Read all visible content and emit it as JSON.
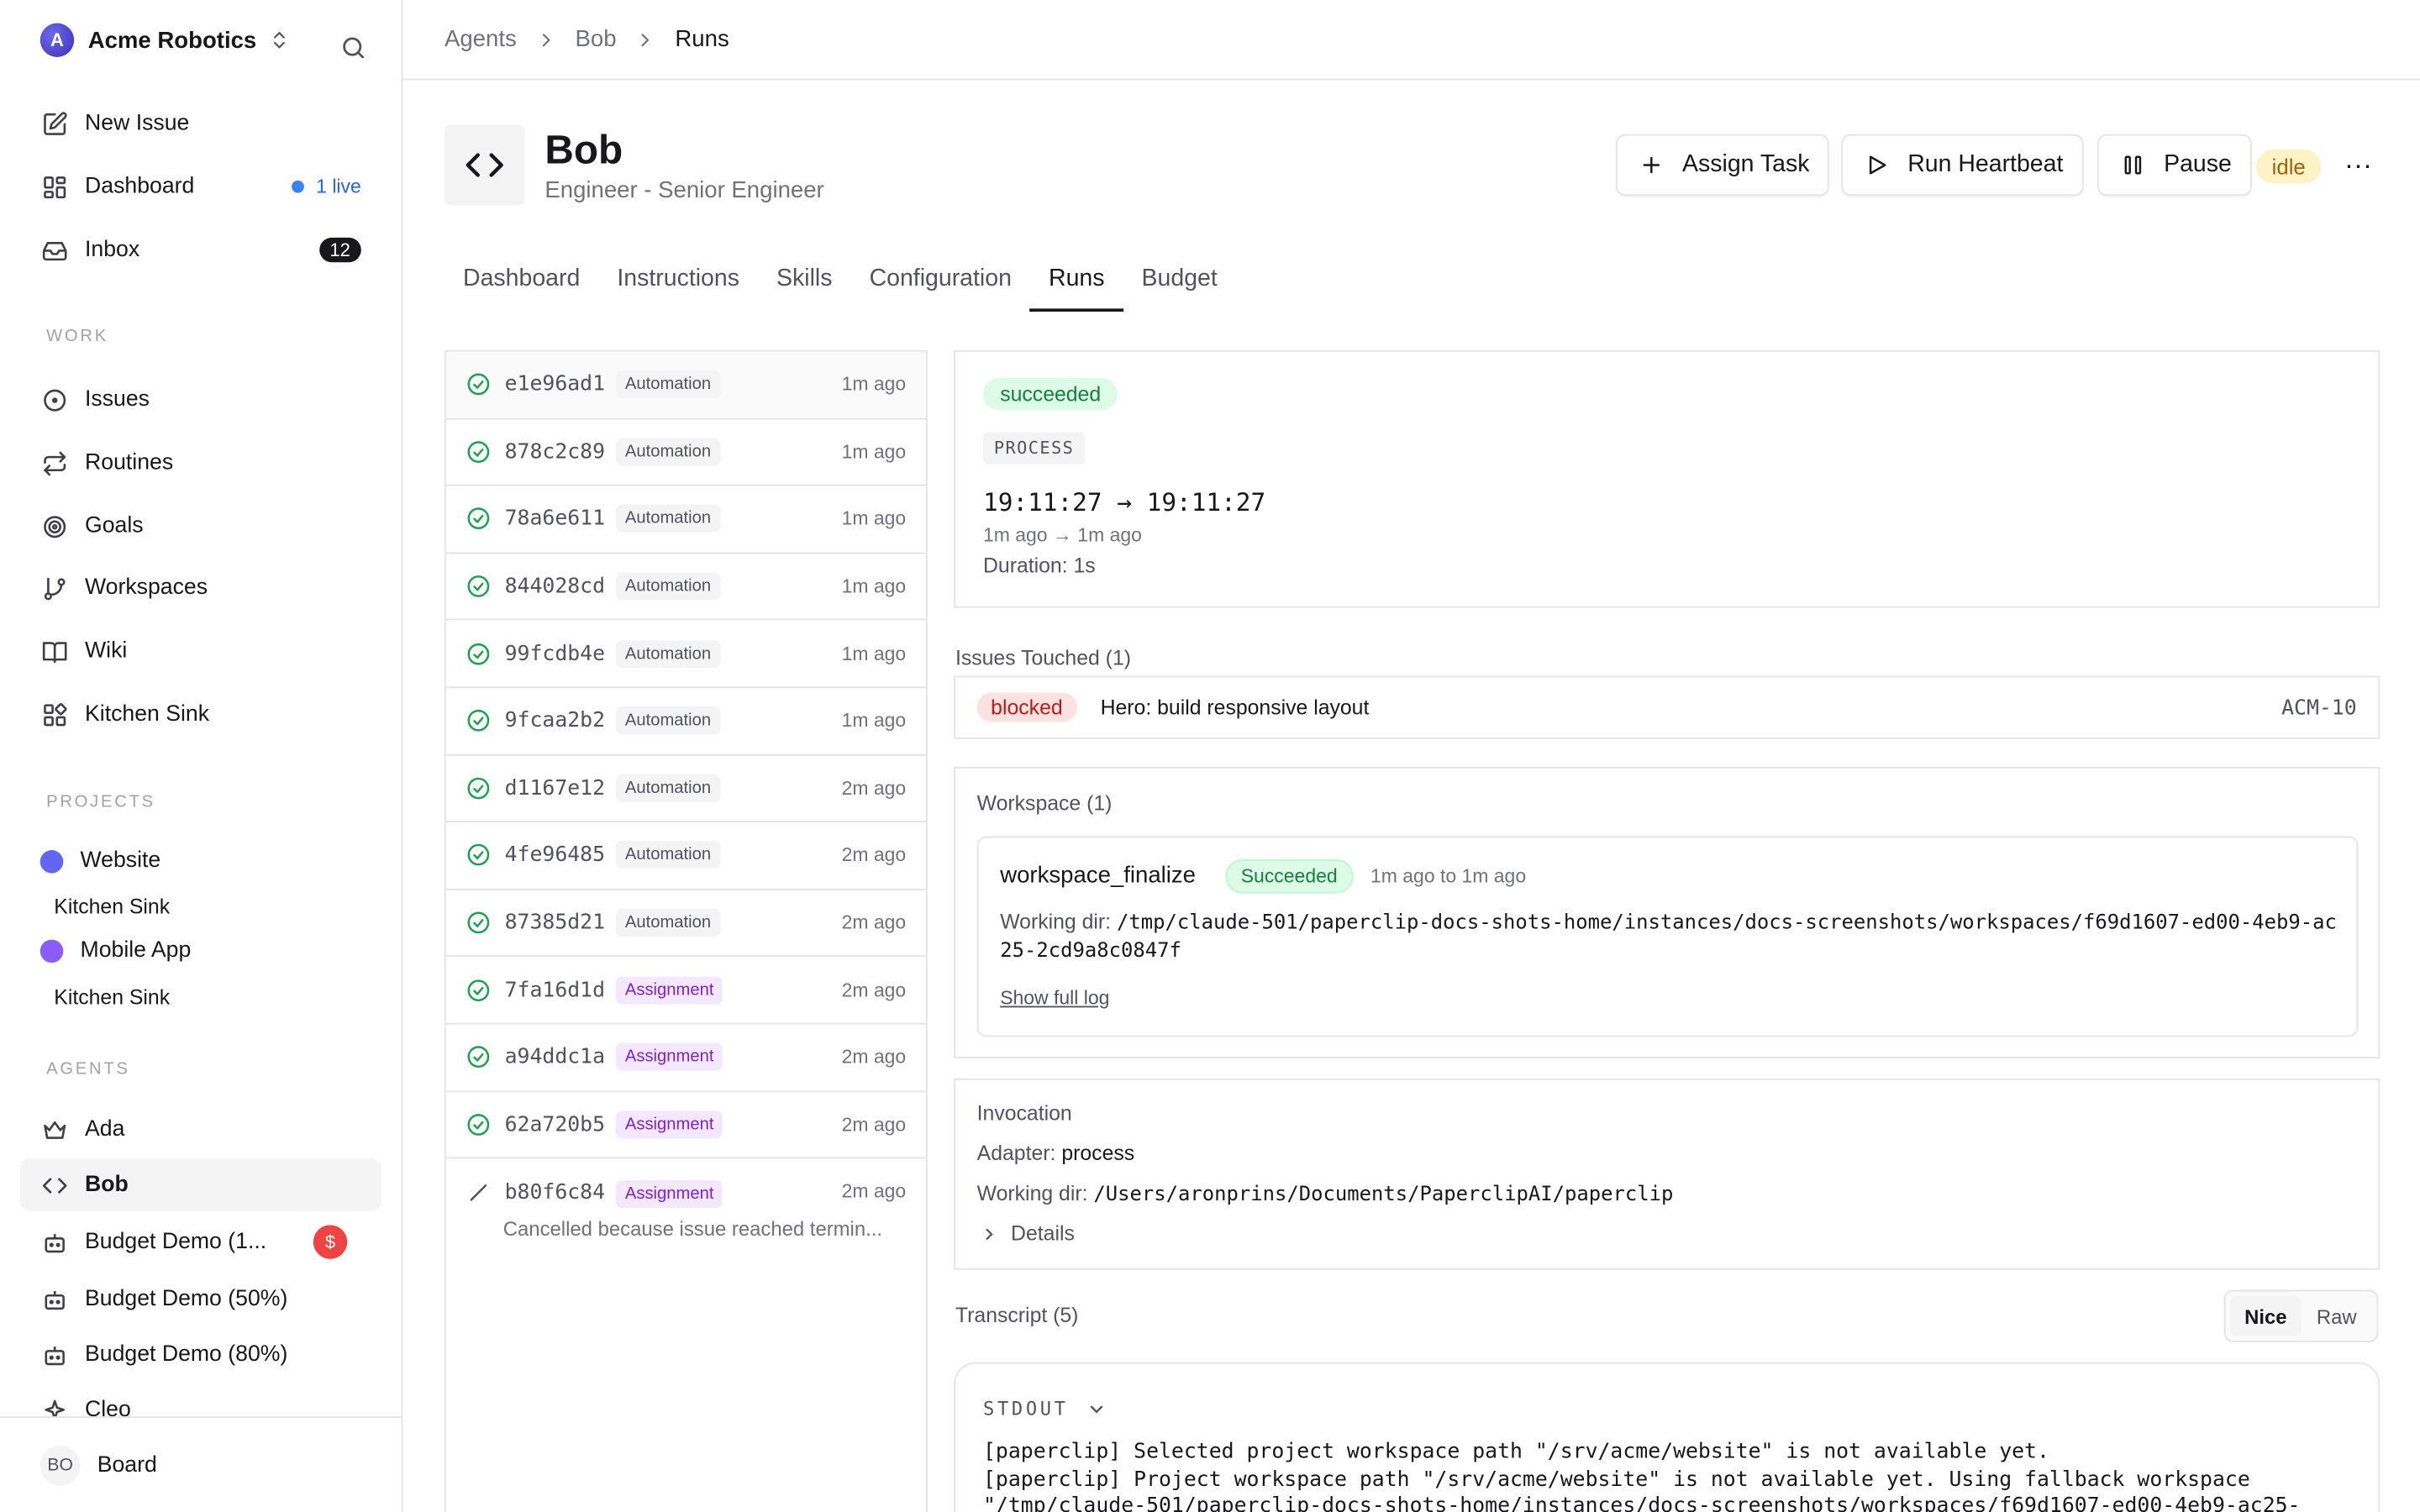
{
  "sidebar": {
    "company": "Acme Robotics",
    "company_initial": "A",
    "nav": [
      {
        "label": "New Issue",
        "icon": "edit-icon"
      },
      {
        "label": "Dashboard",
        "icon": "dashboard-icon",
        "live": "1 live"
      },
      {
        "label": "Inbox",
        "icon": "inbox-icon",
        "count": "12"
      }
    ],
    "work_label": "WORK",
    "work": [
      {
        "label": "Issues",
        "icon": "circle-dot-icon"
      },
      {
        "label": "Routines",
        "icon": "repeat-icon"
      },
      {
        "label": "Goals",
        "icon": "target-icon"
      },
      {
        "label": "Workspaces",
        "icon": "git-branch-icon"
      },
      {
        "label": "Wiki",
        "icon": "book-icon"
      },
      {
        "label": "Kitchen Sink",
        "icon": "blocks-icon"
      }
    ],
    "projects_label": "PROJECTS",
    "projects": [
      {
        "label": "Website",
        "color": "#6366f1",
        "sub": "Kitchen Sink"
      },
      {
        "label": "Mobile App",
        "color": "#8b5cf6",
        "sub": "Kitchen Sink"
      }
    ],
    "agents_label": "AGENTS",
    "agents": [
      {
        "label": "Ada",
        "icon": "crown-icon"
      },
      {
        "label": "Bob",
        "icon": "code-icon"
      },
      {
        "label": "Budget Demo (1...",
        "icon": "bot-icon",
        "badge": "$"
      },
      {
        "label": "Budget Demo (50%)",
        "icon": "bot-icon"
      },
      {
        "label": "Budget Demo (80%)",
        "icon": "bot-icon"
      },
      {
        "label": "Cleo",
        "icon": "sparkle-icon"
      }
    ],
    "footer": {
      "initials": "BO",
      "label": "Board"
    }
  },
  "breadcrumb": [
    "Agents",
    "Bob",
    "Runs"
  ],
  "agent": {
    "name": "Bob",
    "role": "Engineer - Senior Engineer",
    "status": "idle"
  },
  "actions": {
    "assign": "Assign Task",
    "heartbeat": "Run Heartbeat",
    "pause": "Pause",
    "more": "···"
  },
  "tabs": [
    "Dashboard",
    "Instructions",
    "Skills",
    "Configuration",
    "Runs",
    "Budget"
  ],
  "active_tab": "Runs",
  "runs": [
    {
      "id": "e1e96ad1",
      "type": "Automation",
      "when": "1m ago"
    },
    {
      "id": "878c2c89",
      "type": "Automation",
      "when": "1m ago"
    },
    {
      "id": "78a6e611",
      "type": "Automation",
      "when": "1m ago"
    },
    {
      "id": "844028cd",
      "type": "Automation",
      "when": "1m ago"
    },
    {
      "id": "99fcdb4e",
      "type": "Automation",
      "when": "1m ago"
    },
    {
      "id": "9fcaa2b2",
      "type": "Automation",
      "when": "1m ago"
    },
    {
      "id": "d1167e12",
      "type": "Automation",
      "when": "2m ago"
    },
    {
      "id": "4fe96485",
      "type": "Automation",
      "when": "2m ago"
    },
    {
      "id": "87385d21",
      "type": "Automation",
      "when": "2m ago"
    },
    {
      "id": "7fa16d1d",
      "type": "Assignment",
      "when": "2m ago"
    },
    {
      "id": "a94ddc1a",
      "type": "Assignment",
      "when": "2m ago"
    },
    {
      "id": "62a720b5",
      "type": "Assignment",
      "when": "2m ago"
    },
    {
      "id": "b80f6c84",
      "type": "Assignment",
      "when": "2m ago",
      "note": "Cancelled because issue reached termin..."
    }
  ],
  "detail": {
    "status": "succeeded",
    "process": "PROCESS",
    "time_range": "19:11:27 → 19:11:27",
    "relative": "1m ago → 1m ago",
    "duration": "Duration: 1s",
    "issues_title": "Issues Touched (1)",
    "issue": {
      "status": "blocked",
      "title": "Hero: build responsive layout",
      "id": "ACM-10"
    },
    "workspace_title": "Workspace (1)",
    "workspace": {
      "name": "workspace_finalize",
      "status": "Succeeded",
      "time": "1m ago to 1m ago",
      "dir_label": "Working dir:",
      "dir": "/tmp/claude-501/paperclip-docs-shots-home/instances/docs-screenshots/workspaces/f69d1607-ed00-4eb9-ac25-2cd9a8c0847f",
      "log_link": "Show full log"
    },
    "invocation": {
      "title": "Invocation",
      "adapter_label": "Adapter:",
      "adapter": "process",
      "dir_label": "Working dir:",
      "dir": "/Users/aronprins/Documents/PaperclipAI/paperclip",
      "details": "Details"
    },
    "transcript_title": "Transcript (5)",
    "toggle": [
      "Nice",
      "Raw"
    ],
    "stdout_label": "STDOUT",
    "log": "[paperclip] Selected project workspace path \"/srv/acme/website\" is not available yet.\n[paperclip] Project workspace path \"/srv/acme/website\" is not available yet. Using fallback workspace\n\"/tmp/claude-501/paperclip-docs-shots-home/instances/docs-screenshots/workspaces/f69d1607-ed00-4eb9-ac25-"
  }
}
